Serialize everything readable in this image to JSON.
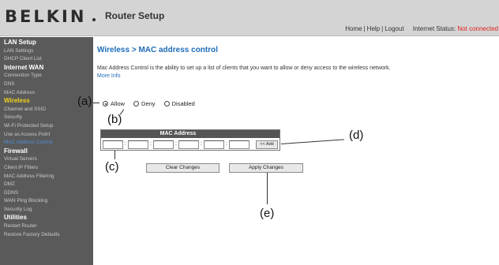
{
  "header": {
    "logo": "BELKIN",
    "product": "Router Setup",
    "nav": [
      "Home",
      "Help",
      "Logout"
    ],
    "status_label": "Internet Status:",
    "status_value": "Not connected",
    "status_color": "#e0201c"
  },
  "sidebar": {
    "lan_setup": {
      "label": "LAN Setup",
      "items": [
        "LAN Settings",
        "DHCP Client List"
      ]
    },
    "internet_wan": {
      "label": "Internet WAN",
      "items": [
        "Connection Type",
        "DNS",
        "MAC Address"
      ]
    },
    "wireless": {
      "label": "Wireless",
      "items": [
        "Channel and SSID",
        "Security",
        "Wi-Fi Protected Setup",
        "Use as Access Point",
        "MAC Address Control"
      ]
    },
    "firewall": {
      "label": "Firewall",
      "items": [
        "Virtual Servers",
        "Client IP Filters",
        "MAC Address Filtering",
        "DMZ",
        "DDNS",
        "WAN Ping Blocking",
        "Security Log"
      ]
    },
    "utilities": {
      "label": "Utilities",
      "items": [
        "Restart Router",
        "Restore Factory Defaults"
      ]
    }
  },
  "main": {
    "title": "Wireless > MAC address control",
    "description": "Mac Address Control is the ability to set up a list of clients that you want to allow or deny access to the wireless network.",
    "more_info": "More Info",
    "mode_options": [
      "Allow",
      "Deny",
      "Disabled"
    ],
    "selected_mode": "Allow",
    "mac_table_header": "MAC Address",
    "mac_octets": [
      "",
      "",
      "",
      "",
      "",
      ""
    ],
    "add_button": "<< Add",
    "clear_button": "Clear Changes",
    "apply_button": "Apply Changes"
  },
  "callouts": [
    "(a)",
    "(b)",
    "(c)",
    "(d)",
    "(e)"
  ],
  "colors": {
    "accent_blue": "#1f6cb8",
    "active_section": "#f0d21c",
    "current_item": "#4f8fd8",
    "sidebar_bg": "#5a5a5a"
  }
}
